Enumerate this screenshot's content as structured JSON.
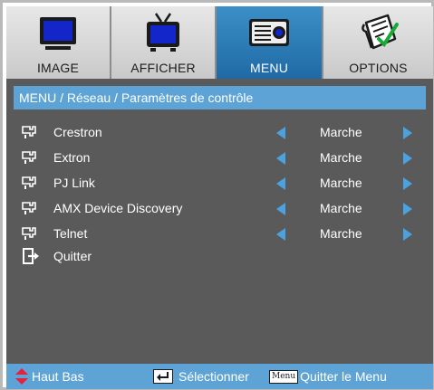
{
  "tabs": [
    {
      "label": "IMAGE",
      "icon": "monitor-icon",
      "active": false
    },
    {
      "label": "AFFICHER",
      "icon": "tv-icon",
      "active": false
    },
    {
      "label": "MENU",
      "icon": "projector-icon",
      "active": true
    },
    {
      "label": "OPTIONS",
      "icon": "checklist-icon",
      "active": false
    }
  ],
  "breadcrumb": "MENU / Réseau / Paramètres de contrôle",
  "items": [
    {
      "label": "Crestron",
      "value": "Marche",
      "icon": "network-port-icon"
    },
    {
      "label": "Extron",
      "value": "Marche",
      "icon": "network-port-icon"
    },
    {
      "label": "PJ Link",
      "value": "Marche",
      "icon": "network-port-icon"
    },
    {
      "label": "AMX Device Discovery",
      "value": "Marche",
      "icon": "network-port-icon"
    },
    {
      "label": "Telnet",
      "value": "Marche",
      "icon": "network-port-icon"
    }
  ],
  "quit": {
    "label": "Quitter",
    "icon": "exit-icon"
  },
  "footer": {
    "nav_label": "Haut Bas",
    "select_label": "Sélectionner",
    "menu_key": "Menu",
    "exit_label": "Quitter le Menu"
  },
  "colors": {
    "background": "#5a5a5a",
    "accent": "#5ea3d6",
    "active_tab": "#2b7cb8",
    "arrow": "#4aa3e0",
    "nav_arrows": "#e8203c"
  }
}
